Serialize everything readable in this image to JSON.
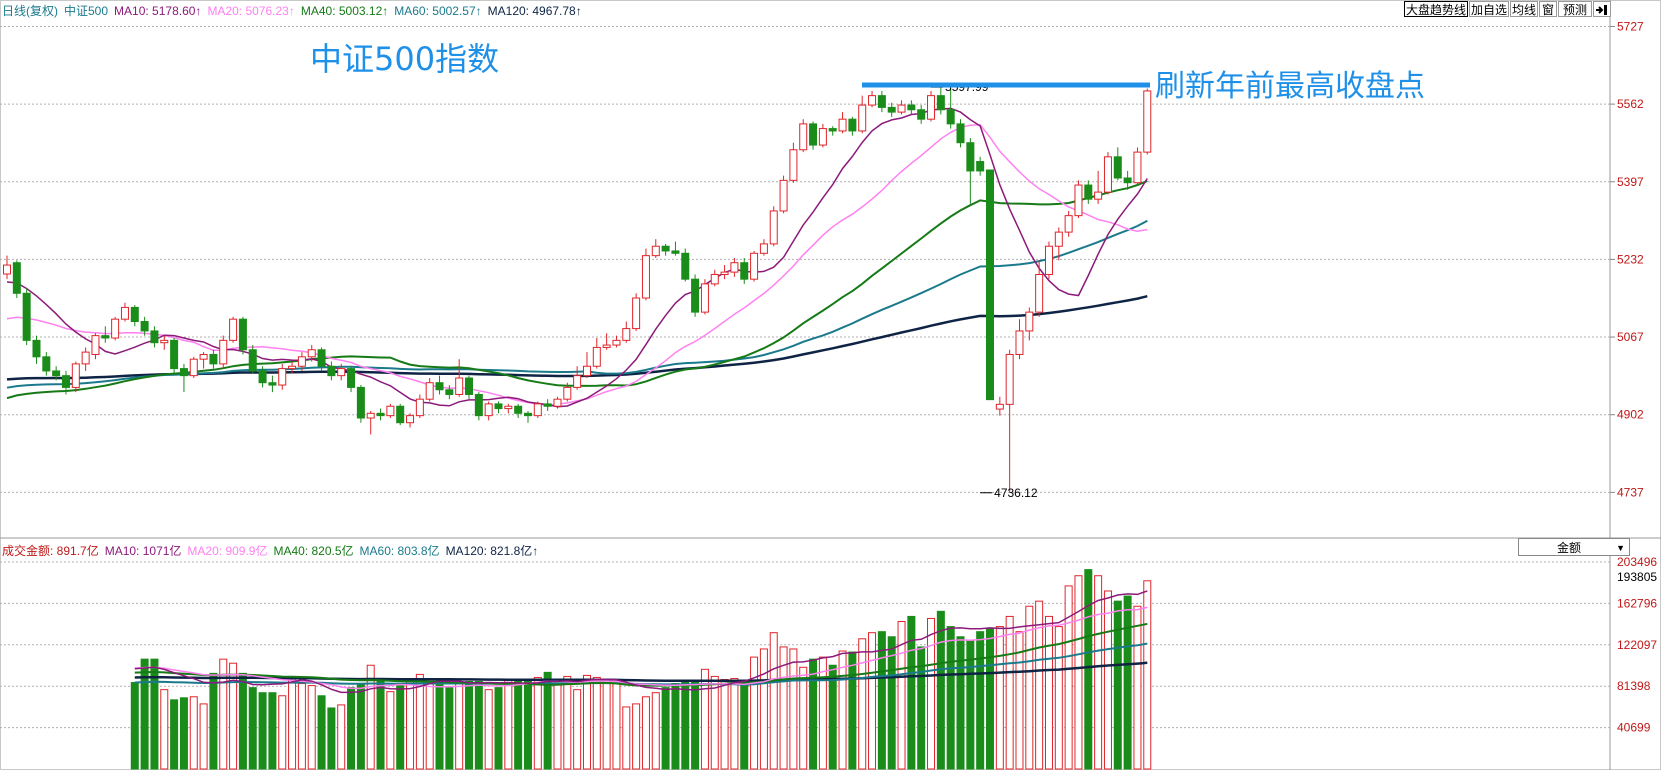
{
  "legend_top": {
    "period": "日线(复权)",
    "name": "中证500",
    "ma10": "MA10: 5178.60↑",
    "ma20": "MA20: 5076.23↑",
    "ma40": "MA40: 5003.12↑",
    "ma60": "MA60: 5002.57↑",
    "ma120": "MA120: 4967.78↑"
  },
  "legend_bottom": {
    "amount": "成交金额: 891.7亿",
    "ma10": "MA10: 1071亿",
    "ma20": "MA20: 909.9亿",
    "ma40": "MA40: 820.5亿",
    "ma60": "MA60: 803.8亿",
    "ma120": "MA120: 821.8亿↑"
  },
  "toolbar": [
    "大盘趋势线",
    "加自选",
    "均线",
    "窗",
    "预测"
  ],
  "toolbar_icon": "exit-icon",
  "volume_select": "金额",
  "annotations": {
    "title": "中证500指数",
    "note": "刷新年前最高收盘点",
    "high_label": "5597.99",
    "low_label": "4736.12"
  },
  "colors": {
    "up": "#e0242a",
    "down": "#1a8c1a",
    "ma10": "#8c1a7a",
    "ma20": "#ff80f0",
    "ma40": "#167a16",
    "ma60": "#1a7a8c",
    "ma120": "#0f2445",
    "annotation": "#1e90e8",
    "grid": "#b0b0b0"
  },
  "chart_data": {
    "type": "candlestick",
    "price_axis": {
      "ticks": [
        5727,
        5562,
        5397,
        5232,
        5067,
        4902,
        4737
      ],
      "range": [
        4640,
        5745
      ]
    },
    "volume_axis": {
      "ticks": [
        203496,
        193805,
        162796,
        122097,
        81398,
        40699
      ],
      "max": 203496
    },
    "last_volume_label": "193805",
    "marked_high": 5597.99,
    "marked_low": 4736.12,
    "candles": [
      [
        5201,
        5220,
        5190,
        5240
      ],
      [
        5225,
        5160,
        5150,
        5230
      ],
      [
        5160,
        5060,
        5050,
        5170
      ],
      [
        5060,
        5025,
        5010,
        5070
      ],
      [
        5025,
        4995,
        4985,
        5035
      ],
      [
        4995,
        4985,
        4975,
        5005
      ],
      [
        4985,
        4960,
        4945,
        4995
      ],
      [
        4960,
        5010,
        4950,
        5015
      ],
      [
        5010,
        5035,
        4995,
        5045
      ],
      [
        5030,
        5070,
        5020,
        5075
      ],
      [
        5070,
        5065,
        5055,
        5090
      ],
      [
        5065,
        5105,
        5060,
        5110
      ],
      [
        5105,
        5130,
        5100,
        5140
      ],
      [
        5130,
        5100,
        5090,
        5135
      ],
      [
        5100,
        5080,
        5070,
        5110
      ],
      [
        5080,
        5055,
        5045,
        5090
      ],
      [
        5055,
        5060,
        5040,
        5070
      ],
      [
        5060,
        5000,
        4990,
        5065
      ],
      [
        5000,
        4985,
        4950,
        5010
      ],
      [
        4985,
        5020,
        4980,
        5025
      ],
      [
        5020,
        5030,
        5000,
        5035
      ],
      [
        5030,
        5010,
        5000,
        5040
      ],
      [
        5010,
        5060,
        5000,
        5070
      ],
      [
        5060,
        5105,
        5055,
        5110
      ],
      [
        5105,
        5040,
        5030,
        5110
      ],
      [
        5040,
        4995,
        4990,
        5050
      ],
      [
        4995,
        4970,
        4960,
        5005
      ],
      [
        4970,
        4965,
        4950,
        4985
      ],
      [
        4965,
        5000,
        4955,
        5010
      ],
      [
        5000,
        5005,
        4990,
        5015
      ],
      [
        5005,
        5025,
        4995,
        5035
      ],
      [
        5025,
        5040,
        5015,
        5050
      ],
      [
        5040,
        5005,
        4995,
        5045
      ],
      [
        5005,
        4985,
        4975,
        5015
      ],
      [
        4985,
        5000,
        4975,
        5010
      ],
      [
        5000,
        4960,
        4950,
        5005
      ],
      [
        4960,
        4895,
        4885,
        4965
      ],
      [
        4895,
        4905,
        4860,
        4910
      ],
      [
        4905,
        4900,
        4890,
        4915
      ],
      [
        4900,
        4920,
        4895,
        4925
      ],
      [
        4920,
        4885,
        4880,
        4925
      ],
      [
        4885,
        4900,
        4875,
        4905
      ],
      [
        4900,
        4935,
        4895,
        4945
      ],
      [
        4935,
        4970,
        4930,
        4980
      ],
      [
        4970,
        4955,
        4945,
        4985
      ],
      [
        4955,
        4945,
        4935,
        4965
      ],
      [
        4945,
        4980,
        4940,
        5020
      ],
      [
        4980,
        4945,
        4935,
        4985
      ],
      [
        4945,
        4900,
        4890,
        4950
      ],
      [
        4900,
        4925,
        4890,
        4930
      ],
      [
        4925,
        4915,
        4905,
        4930
      ],
      [
        4915,
        4920,
        4905,
        4925
      ],
      [
        4920,
        4905,
        4895,
        4925
      ],
      [
        4905,
        4900,
        4885,
        4910
      ],
      [
        4900,
        4925,
        4895,
        4930
      ],
      [
        4925,
        4920,
        4910,
        4935
      ],
      [
        4920,
        4935,
        4915,
        4940
      ],
      [
        4935,
        4960,
        4930,
        4970
      ],
      [
        4960,
        4985,
        4955,
        5005
      ],
      [
        4985,
        5005,
        4980,
        5035
      ],
      [
        5005,
        5045,
        5000,
        5065
      ],
      [
        5045,
        5050,
        5040,
        5075
      ],
      [
        5050,
        5060,
        5045,
        5070
      ],
      [
        5060,
        5085,
        5055,
        5100
      ],
      [
        5085,
        5150,
        5080,
        5160
      ],
      [
        5150,
        5240,
        5145,
        5255
      ],
      [
        5240,
        5260,
        5235,
        5275
      ],
      [
        5260,
        5250,
        5240,
        5265
      ],
      [
        5250,
        5245,
        5240,
        5270
      ],
      [
        5245,
        5190,
        5185,
        5255
      ],
      [
        5190,
        5120,
        5110,
        5200
      ],
      [
        5120,
        5180,
        5115,
        5190
      ],
      [
        5180,
        5200,
        5175,
        5210
      ],
      [
        5200,
        5205,
        5190,
        5220
      ],
      [
        5205,
        5225,
        5195,
        5235
      ],
      [
        5225,
        5190,
        5180,
        5235
      ],
      [
        5190,
        5245,
        5185,
        5250
      ],
      [
        5245,
        5265,
        5240,
        5275
      ],
      [
        5265,
        5335,
        5260,
        5345
      ],
      [
        5335,
        5400,
        5330,
        5410
      ],
      [
        5400,
        5465,
        5395,
        5480
      ],
      [
        5465,
        5520,
        5460,
        5530
      ],
      [
        5520,
        5475,
        5465,
        5525
      ],
      [
        5475,
        5510,
        5470,
        5520
      ],
      [
        5510,
        5505,
        5495,
        5515
      ],
      [
        5505,
        5530,
        5500,
        5545
      ],
      [
        5530,
        5505,
        5495,
        5535
      ],
      [
        5505,
        5560,
        5500,
        5580
      ],
      [
        5560,
        5580,
        5555,
        5590
      ],
      [
        5580,
        5555,
        5545,
        5590
      ],
      [
        5555,
        5545,
        5535,
        5565
      ],
      [
        5545,
        5560,
        5540,
        5570
      ],
      [
        5560,
        5550,
        5540,
        5570
      ],
      [
        5550,
        5530,
        5520,
        5560
      ],
      [
        5530,
        5580,
        5525,
        5590
      ],
      [
        5580,
        5550,
        5540,
        5598
      ],
      [
        5550,
        5520,
        5510,
        5595
      ],
      [
        5520,
        5480,
        5470,
        5530
      ],
      [
        5480,
        5420,
        5350,
        5490
      ],
      [
        5440,
        5420,
        5410,
        5450
      ],
      [
        5422,
        4934,
        4934,
        5422
      ],
      [
        4914,
        4924,
        4900,
        4940
      ],
      [
        4924,
        5030,
        4736,
        5040
      ],
      [
        5030,
        5080,
        5020,
        5105
      ],
      [
        5080,
        5120,
        5060,
        5130
      ],
      [
        5120,
        5200,
        5110,
        5230
      ],
      [
        5200,
        5260,
        5190,
        5270
      ],
      [
        5260,
        5290,
        5230,
        5300
      ],
      [
        5290,
        5325,
        5280,
        5335
      ],
      [
        5325,
        5390,
        5320,
        5400
      ],
      [
        5390,
        5360,
        5350,
        5400
      ],
      [
        5360,
        5375,
        5350,
        5420
      ],
      [
        5375,
        5450,
        5370,
        5460
      ],
      [
        5450,
        5405,
        5400,
        5470
      ],
      [
        5405,
        5395,
        5380,
        5420
      ],
      [
        5395,
        5460,
        5390,
        5470
      ],
      [
        5460,
        5590,
        5455,
        5595
      ]
    ],
    "volume": [
      85,
      108,
      108,
      78,
      68,
      70,
      71,
      64,
      94,
      108,
      104,
      94,
      80,
      75,
      75,
      72,
      90,
      84,
      82,
      72,
      60,
      63,
      80,
      83,
      102,
      86,
      76,
      82,
      86,
      93,
      88,
      87,
      80,
      84,
      86,
      86,
      78,
      80,
      88,
      88,
      86,
      90,
      95,
      84,
      91,
      78,
      92,
      90,
      87,
      84,
      61,
      64,
      71,
      75,
      80,
      84,
      86,
      86,
      98,
      91,
      88,
      89,
      85,
      110,
      118,
      134,
      120,
      118,
      100,
      108,
      110,
      102,
      116,
      115,
      128,
      134,
      135,
      130,
      145,
      150,
      120,
      148,
      155,
      140,
      130,
      126,
      135,
      138,
      140,
      150,
      135,
      160,
      165,
      150,
      140,
      180,
      190,
      196,
      190,
      175,
      165,
      170,
      160,
      185
    ]
  }
}
